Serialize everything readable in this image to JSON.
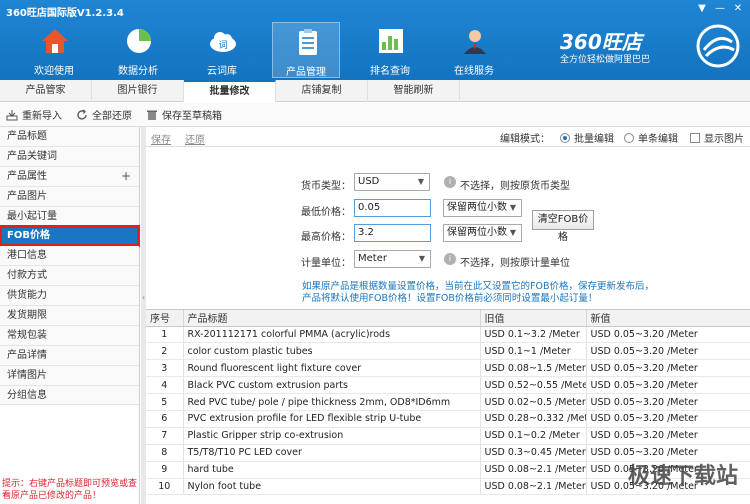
{
  "window": {
    "title": "360旺店国际版V1.2.3.4",
    "controls": [
      "▼",
      "—",
      "✕"
    ]
  },
  "nav": [
    {
      "label": "欢迎使用",
      "icon": "home-icon"
    },
    {
      "label": "数据分析",
      "icon": "pie-chart-icon"
    },
    {
      "label": "云词库",
      "icon": "cloud-icon"
    },
    {
      "label": "产品管理",
      "icon": "clipboard-icon"
    },
    {
      "label": "排名查询",
      "icon": "ranking-icon"
    },
    {
      "label": "在线服务",
      "icon": "agent-icon"
    }
  ],
  "brand": {
    "title": "360旺店",
    "subtitle": "全方位轻松做阿里巴巴"
  },
  "subtabs": [
    "产品管家",
    "图片银行",
    "批量修改",
    "店铺复制",
    "智能刷新"
  ],
  "toolbar": {
    "reimport": "重新导入",
    "restore_all": "全部还原",
    "save_draft": "保存至草稿箱"
  },
  "sidebar": {
    "items": [
      "产品标题",
      "产品关键词",
      "产品属性",
      "产品图片",
      "最小起订量",
      "FOB价格",
      "港口信息",
      "付款方式",
      "供货能力",
      "发货期限",
      "常规包装",
      "产品详情",
      "详情图片",
      "分组信息"
    ],
    "hint": "提示：右键产品标题即可预览或查看原产品已修改的产品！"
  },
  "main": {
    "save_link": "保存",
    "restore_link": "还原",
    "edit_mode_label": "编辑模式：",
    "mode_batch": "批量编辑",
    "mode_single": "单条编辑",
    "show_images": "显示图片",
    "currency_label": "货币类型：",
    "currency_value": "USD",
    "currency_hint": "不选择，则按原货币类型",
    "min_price_label": "最低价格：",
    "min_price_value": "0.05",
    "max_price_label": "最高价格：",
    "max_price_value": "3.2",
    "decimal_option": "保留两位小数",
    "clear_fob_button": "清空FOB价格",
    "unit_label": "计量单位：",
    "unit_value": "Meter",
    "unit_hint": "不选择，则按原计量单位",
    "note_line1": "如果原产品是根据数量设置价格，当前在此又设置它的FOB价格，保存更新发布后，",
    "note_line2": "产品将默认使用FOB价格！设置FOB价格前必须同时设置最小起订量！"
  },
  "table": {
    "headers": [
      "序号",
      "产品标题",
      "旧值",
      "新值"
    ],
    "rows": [
      [
        "1",
        "RX-201112171 colorful PMMA (acrylic)rods",
        "USD 0.1~3.2 /Meter",
        "USD 0.05~3.20 /Meter"
      ],
      [
        "2",
        "color custom plastic tubes",
        "USD 0.1~1 /Meter",
        "USD 0.05~3.20 /Meter"
      ],
      [
        "3",
        "Round fluorescent light fixture cover",
        "USD 0.08~1.5 /Meter",
        "USD 0.05~3.20 /Meter"
      ],
      [
        "4",
        "Black PVC custom extrusion parts",
        "USD 0.52~0.55 /Meter",
        "USD 0.05~3.20 /Meter"
      ],
      [
        "5",
        "Red PVC tube/ pole / pipe thickness 2mm, OD8*ID6mm",
        "USD 0.02~0.5 /Meter",
        "USD 0.05~3.20 /Meter"
      ],
      [
        "6",
        "PVC extrusion profile for LED flexible strip U-tube",
        "USD 0.28~0.332 /Meter",
        "USD 0.05~3.20 /Meter"
      ],
      [
        "7",
        "Plastic Gripper strip co-extrusion",
        "USD 0.1~0.2 /Meter",
        "USD 0.05~3.20 /Meter"
      ],
      [
        "8",
        "T5/T8/T10 PC LED cover",
        "USD 0.3~0.45 /Meter",
        "USD 0.05~3.20 /Meter"
      ],
      [
        "9",
        "hard tube",
        "USD 0.08~2.1 /Meter",
        "USD 0.05~3.20 /Meter"
      ],
      [
        "10",
        "Nylon foot tube",
        "USD 0.08~2.1 /Meter",
        "USD 0.05~3.20 /Meter"
      ]
    ]
  },
  "watermark": "极速下载站"
}
